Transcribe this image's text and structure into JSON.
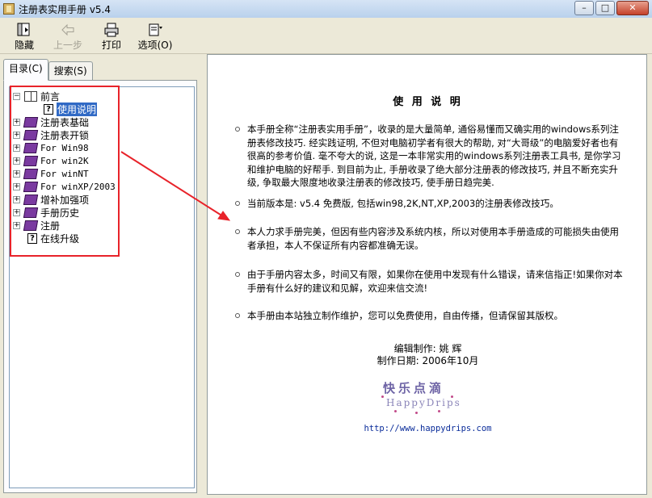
{
  "window": {
    "title": "注册表实用手册 v5.4",
    "controls": {
      "minimize": "–",
      "maximize": "□",
      "close": "✕"
    }
  },
  "toolbar": {
    "hide_label": "隐藏",
    "back_label": "上一步",
    "print_label": "打印",
    "options_label": "选项(O)"
  },
  "tabs": {
    "contents_label": "目录(C)",
    "search_label": "搜索(S)"
  },
  "tree": {
    "items": [
      {
        "label": "前言",
        "state": "expanded",
        "icon": "book-open-icon"
      },
      {
        "label": "使用说明",
        "state": "leaf",
        "icon": "help-topic-icon",
        "selected": true
      },
      {
        "label": "注册表基础",
        "state": "collapsed",
        "icon": "book-closed-icon"
      },
      {
        "label": "注册表开锁",
        "state": "collapsed",
        "icon": "book-closed-icon"
      },
      {
        "label": "For Win98",
        "state": "collapsed",
        "icon": "book-closed-icon"
      },
      {
        "label": "For win2K",
        "state": "collapsed",
        "icon": "book-closed-icon"
      },
      {
        "label": "For winNT",
        "state": "collapsed",
        "icon": "book-closed-icon"
      },
      {
        "label": "For winXP/2003",
        "state": "collapsed",
        "icon": "book-closed-icon"
      },
      {
        "label": "增补加强项",
        "state": "collapsed",
        "icon": "book-closed-icon"
      },
      {
        "label": "手册历史",
        "state": "collapsed",
        "icon": "book-closed-icon"
      },
      {
        "label": "注册",
        "state": "collapsed",
        "icon": "book-closed-icon"
      },
      {
        "label": "在线升级",
        "state": "leaf",
        "icon": "help-topic-icon"
      }
    ]
  },
  "content": {
    "title": "使 用 说 明",
    "paragraphs": [
      "本手册全称“注册表实用手册”，收录的是大量简单, 通俗易懂而又确实用的windows系列注册表修改技巧. 经实践证明, 不但对电脑初学者有很大的帮助, 对“大哥级”的电脑爱好者也有很高的参考价值. 毫不夸大的说, 这是一本非常实用的windows系列注册表工具书, 是你学习和维护电脑的好帮手. 到目前为止, 手册收录了绝大部分注册表的修改技巧, 并且不断充实升级, 争取最大限度地收录注册表的修改技巧, 使手册日趋完美.",
      "当前版本是:  v5.4 免费版, 包括win98,2K,NT,XP,2003的注册表修改技巧。",
      "本人力求手册完美，但因有些内容涉及系统内核，所以对使用本手册造成的可能损失由使用者承担，本人不保证所有内容都准确无误。",
      "由于手册内容太多，时间又有限，如果你在使用中发现有什么错误，请来信指正!如果你对本手册有什么好的建议和见解，欢迎来信交流!",
      "本手册由本站独立制作维护，您可以免费使用，自由传播，但请保留其版权。"
    ],
    "editor": "编辑制作: 姚 辉",
    "date": "制作日期: 2006年10月",
    "logo_cn": "快乐点滴",
    "logo_en": "HappyDrips",
    "url": "http://www.happydrips.com"
  },
  "annotation": {
    "color": "#e8232a"
  }
}
